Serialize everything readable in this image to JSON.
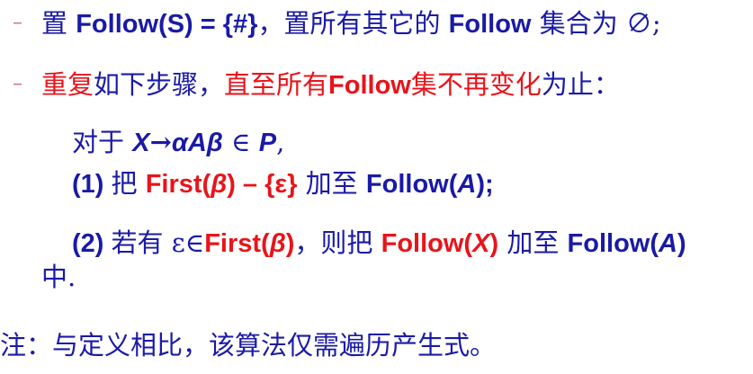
{
  "colors": {
    "text": "#1a1aa6",
    "emphasis": "#e8141b",
    "bullet": "#d07a8a"
  },
  "bullet_glyph": "–",
  "line1": {
    "p1": "置 ",
    "p2": "Follow(S) = {#}",
    "p3": "，置所有其它的 ",
    "p4": "Follow",
    "p5": " 集合为 ∅;"
  },
  "line2": {
    "p1": "重复",
    "p2": "如下步骤，",
    "p3": "直至所有",
    "p4": "Follow",
    "p5": "集不再变化",
    "p6": "为止："
  },
  "rule": {
    "p1": "对于 ",
    "p2": "X",
    "p3": "→",
    "p4": "αAβ",
    "p5": " ∈ ",
    "p6": "P",
    "p7": ","
  },
  "step1": {
    "p1": "(1) ",
    "p2": "把 ",
    "p3": "First(",
    "p4": "β",
    "p5": ") – {ε}",
    "p6": " 加至 ",
    "p7": "Follow(",
    "p8": "A",
    "p9": ");"
  },
  "step2": {
    "p1": "(2) ",
    "p2": "若有 ε∈",
    "p3": "First(",
    "p4": "β",
    "p5": ")",
    "p6": "，则把 ",
    "p7": "Follow(",
    "p8": "X",
    "p9": ")",
    "p10": " 加至 ",
    "p11": "Follow(",
    "p12": "A",
    "p13": ")"
  },
  "step2_cont": "中.",
  "note": "注：与定义相比，该算法仅需遍历产生式。"
}
